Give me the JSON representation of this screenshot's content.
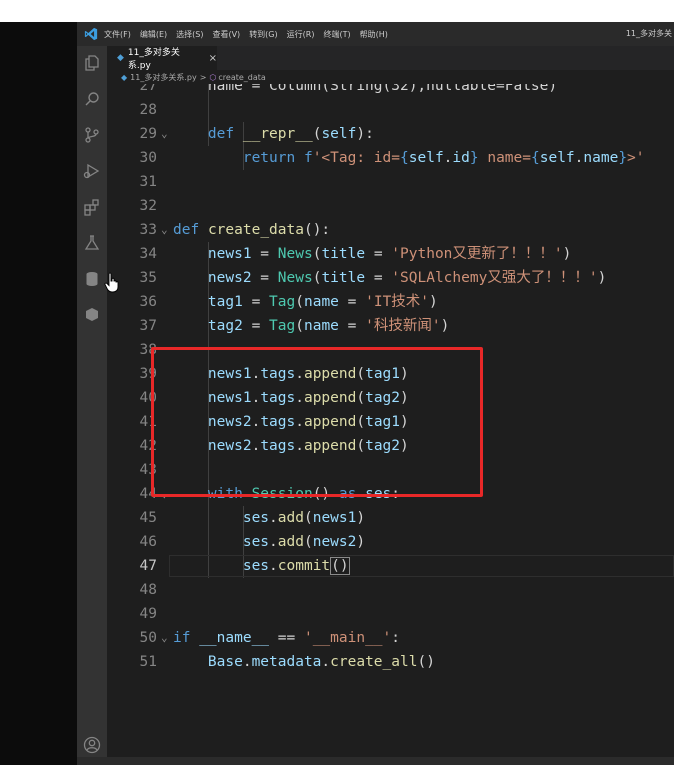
{
  "menubar": {
    "items": [
      "文件(F)",
      "编辑(E)",
      "选择(S)",
      "查看(V)",
      "转到(G)",
      "运行(R)",
      "终端(T)",
      "帮助(H)"
    ],
    "window_title": "11_多对多关"
  },
  "tab": {
    "filename": "11_多对多关系.py",
    "close": "×"
  },
  "breadcrumb": {
    "file": "11_多对多关系.py",
    "separator": ">",
    "symbol": "create_data"
  },
  "activity_bar": {
    "icons": [
      "explorer-icon",
      "search-icon",
      "source-control-icon",
      "run-debug-icon",
      "extensions-icon",
      "testing-icon",
      "database-icon",
      "package-icon",
      "account-icon"
    ]
  },
  "editor": {
    "active_line": "47",
    "lines": [
      {
        "num": "27",
        "html": "    name = Column(String(32),nullable=False)"
      },
      {
        "num": "28",
        "html": ""
      },
      {
        "num": "29",
        "html": "    <span class=\"kw\">def</span> <span class=\"fn\">__repr__</span>(<span class=\"param\">self</span>):"
      },
      {
        "num": "30",
        "html": "        <span class=\"kw\">return</span> <span class=\"kw\">f</span><span class=\"str\">'&lt;Tag: id=</span><span class=\"kw\">{</span><span class=\"param\">self</span>.<span class=\"param\">id</span><span class=\"kw\">}</span><span class=\"str\"> name=</span><span class=\"kw\">{</span><span class=\"param\">self</span>.<span class=\"param\">name</span><span class=\"kw\">}</span><span class=\"str\">&gt;'</span>"
      },
      {
        "num": "31",
        "html": ""
      },
      {
        "num": "32",
        "html": ""
      },
      {
        "num": "33",
        "html": "<span class=\"kw\">def</span> <span class=\"fn\">create_data</span>():"
      },
      {
        "num": "34",
        "html": "    <span class=\"param\">news1</span> = <span class=\"cls\">News</span>(<span class=\"param\">title</span> = <span class=\"str\">'Python又更新了！！！'</span>)"
      },
      {
        "num": "35",
        "html": "    <span class=\"param\">news2</span> = <span class=\"cls\">News</span>(<span class=\"param\">title</span> = <span class=\"str\">'SQLAlchemy又强大了！！！'</span>)"
      },
      {
        "num": "36",
        "html": "    <span class=\"param\">tag1</span> = <span class=\"cls\">Tag</span>(<span class=\"param\">name</span> = <span class=\"str\">'IT技术'</span>)"
      },
      {
        "num": "37",
        "html": "    <span class=\"param\">tag2</span> = <span class=\"cls\">Tag</span>(<span class=\"param\">name</span> = <span class=\"str\">'科技新闻'</span>)"
      },
      {
        "num": "38",
        "html": ""
      },
      {
        "num": "39",
        "html": "    <span class=\"param\">news1</span>.<span class=\"param\">tags</span>.<span class=\"fn\">append</span>(<span class=\"param\">tag1</span>)"
      },
      {
        "num": "40",
        "html": "    <span class=\"param\">news1</span>.<span class=\"param\">tags</span>.<span class=\"fn\">append</span>(<span class=\"param\">tag2</span>)"
      },
      {
        "num": "41",
        "html": "    <span class=\"param\">news2</span>.<span class=\"param\">tags</span>.<span class=\"fn\">append</span>(<span class=\"param\">tag1</span>)"
      },
      {
        "num": "42",
        "html": "    <span class=\"param\">news2</span>.<span class=\"param\">tags</span>.<span class=\"fn\">append</span>(<span class=\"param\">tag2</span>)"
      },
      {
        "num": "43",
        "html": ""
      },
      {
        "num": "44",
        "html": "    <span class=\"kw\">with</span> <span class=\"cls\">Session</span>() <span class=\"kw\">as</span> <span class=\"param\">ses</span>:"
      },
      {
        "num": "45",
        "html": "        <span class=\"param\">ses</span>.<span class=\"fn\">add</span>(<span class=\"param\">news1</span>)"
      },
      {
        "num": "46",
        "html": "        <span class=\"param\">ses</span>.<span class=\"fn\">add</span>(<span class=\"param\">news2</span>)"
      },
      {
        "num": "47",
        "html": "        <span class=\"param\">ses</span>.<span class=\"fn\">commit</span><span class=\"bracket-box\">()</span>"
      },
      {
        "num": "48",
        "html": ""
      },
      {
        "num": "49",
        "html": ""
      },
      {
        "num": "50",
        "html": "<span class=\"kw\">if</span> <span class=\"param\">__name__</span> == <span class=\"str\">'__main__'</span>:"
      },
      {
        "num": "51",
        "html": "    <span class=\"param\">Base</span>.<span class=\"param\">metadata</span>.<span class=\"fn\">create_all</span>()"
      }
    ],
    "fold_lines": [
      "29",
      "33",
      "44",
      "50"
    ]
  },
  "colors": {
    "highlight_box": "#e82828",
    "editor_bg": "#1e1e1e"
  }
}
